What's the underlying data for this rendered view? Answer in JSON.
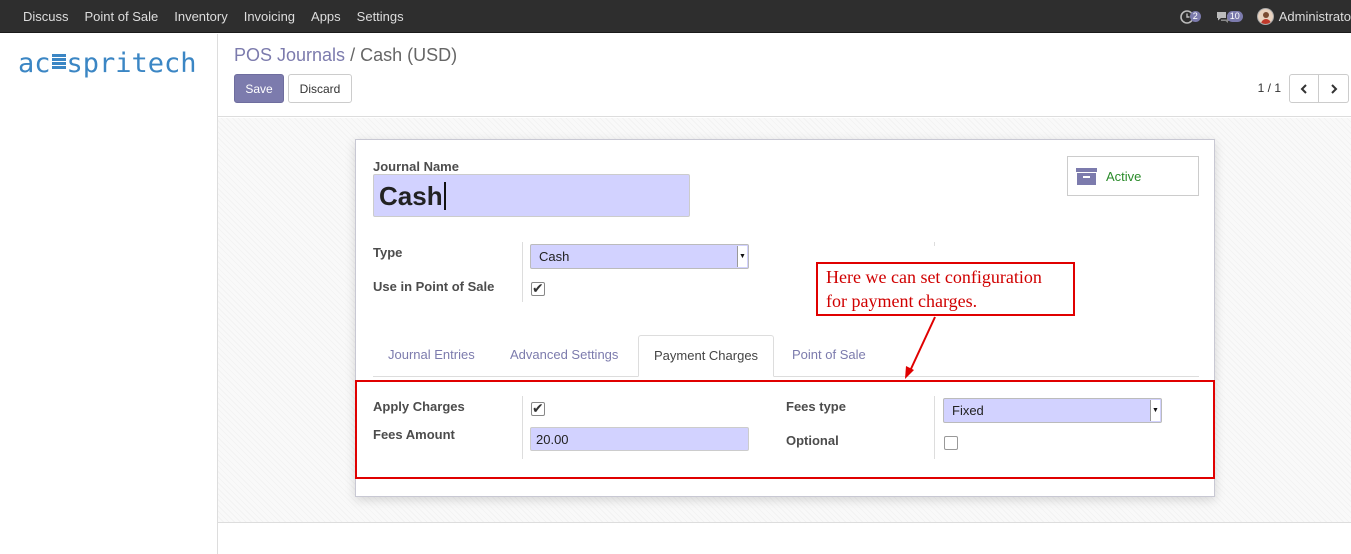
{
  "topbar": {
    "menu": [
      "Discuss",
      "Point of Sale",
      "Inventory",
      "Invoicing",
      "Apps",
      "Settings"
    ],
    "activity_count": "2",
    "messages_count": "10",
    "user_name": "Administrato"
  },
  "logo": {
    "prefix": "ac",
    "suffix": "spritech"
  },
  "breadcrumb": {
    "parent": "POS Journals",
    "separator": "/",
    "current": "Cash (USD)"
  },
  "buttons": {
    "save": "Save",
    "discard": "Discard"
  },
  "pager": {
    "value": "1 / 1"
  },
  "form": {
    "journal_name_label": "Journal Name",
    "journal_name_value": "Cash",
    "active_label": "Active",
    "type_label": "Type",
    "type_value": "Cash",
    "use_in_pos_label": "Use in Point of Sale",
    "use_in_pos_checked": true
  },
  "tabs": [
    {
      "label": "Journal Entries",
      "active": false
    },
    {
      "label": "Advanced Settings",
      "active": false
    },
    {
      "label": "Payment Charges",
      "active": true
    },
    {
      "label": "Point of Sale",
      "active": false
    }
  ],
  "payment_charges": {
    "apply_charges_label": "Apply Charges",
    "apply_charges_checked": true,
    "fees_amount_label": "Fees Amount",
    "fees_amount_value": "20.00",
    "fees_type_label": "Fees type",
    "fees_type_value": "Fixed",
    "optional_label": "Optional",
    "optional_checked": false
  },
  "annotation": {
    "line1": "Here we can set configuration",
    "line2": "for payment charges.",
    "color": "#e00000"
  },
  "colors": {
    "primary": "#7c7bad",
    "input_bg": "#d2d2ff",
    "active_green": "#2a8b2a",
    "topbar_bg": "#2e2e2e"
  }
}
